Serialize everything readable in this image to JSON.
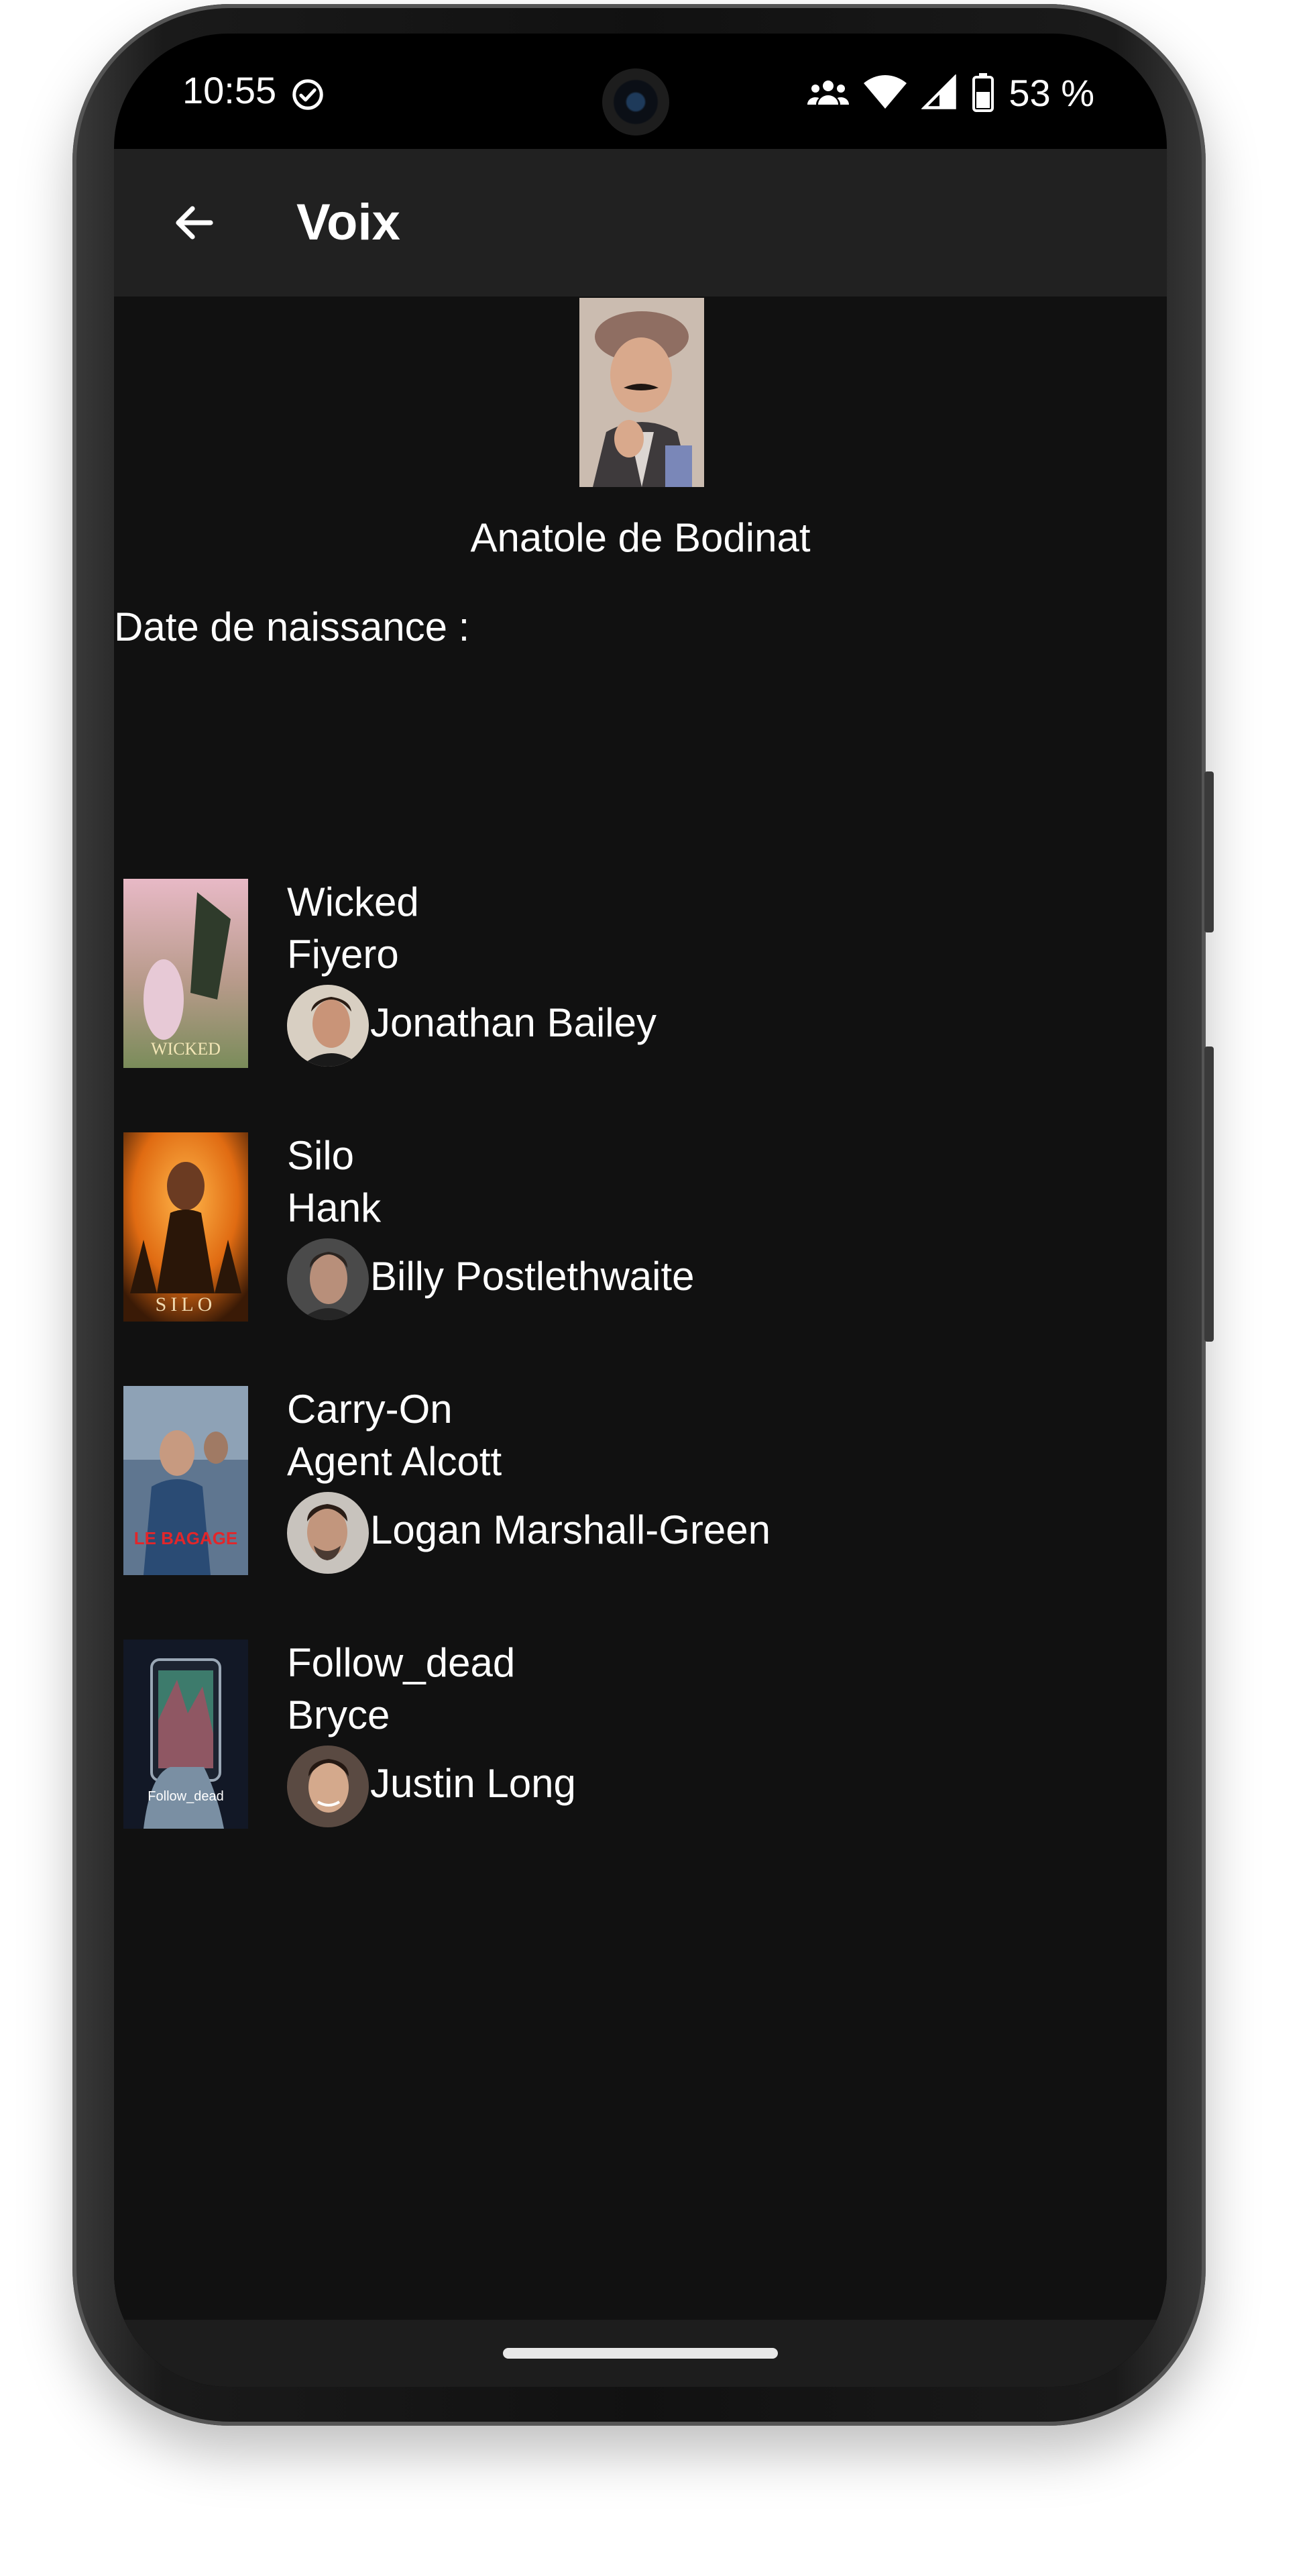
{
  "status_bar": {
    "time": "10:55",
    "battery_percent": "53 %",
    "icons": [
      "check-circle-icon",
      "people-icon",
      "wifi-icon",
      "signal-icon",
      "battery-icon"
    ]
  },
  "app_bar": {
    "title": "Voix",
    "back_icon": "arrow-left-icon"
  },
  "profile": {
    "name": "Anatole de Bodinat",
    "birth_date_label": "Date de naissance :",
    "birth_date_value": ""
  },
  "credits": [
    {
      "title": "Wicked",
      "role": "Fiyero",
      "actor": "Jonathan Bailey",
      "poster_text": "WICKED"
    },
    {
      "title": "Silo",
      "role": "Hank",
      "actor": "Billy Postlethwaite",
      "poster_text": "SILO"
    },
    {
      "title": "Carry-On",
      "role": "Agent Alcott",
      "actor": "Logan Marshall-Green",
      "poster_text": "LE BAGAGE"
    },
    {
      "title": "Follow_dead",
      "role": "Bryce",
      "actor": "Justin Long",
      "poster_text": "Follow_dead"
    }
  ],
  "colors": {
    "background": "#111111",
    "app_bar": "#212121",
    "text": "#ffffff"
  }
}
